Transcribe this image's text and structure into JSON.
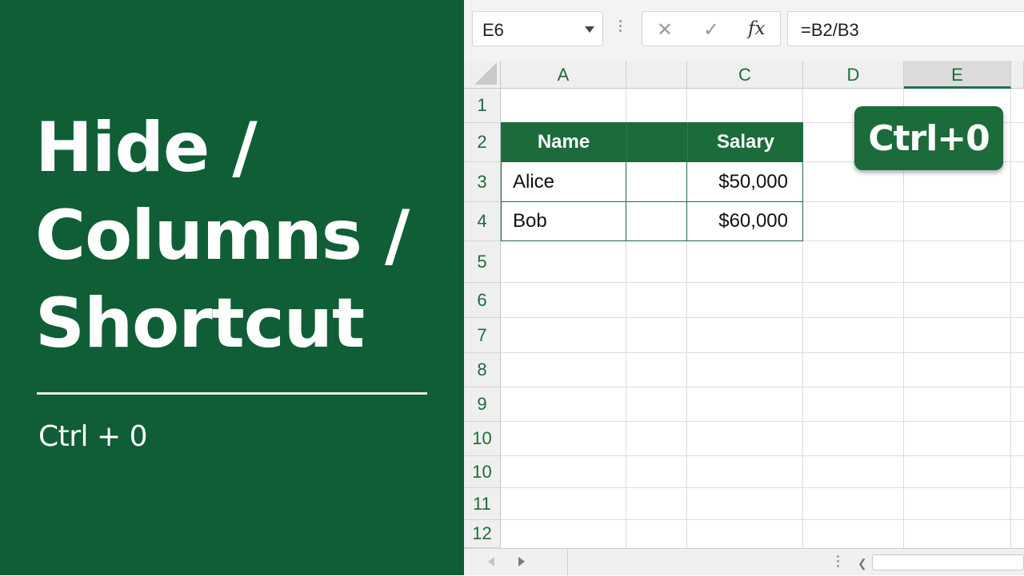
{
  "left_panel": {
    "title_lines": [
      "Hide /",
      "Columns /",
      "Shortcut"
    ],
    "subtitle": "Ctrl + 0",
    "background_color": "#0f5e36"
  },
  "formula_bar": {
    "name_box": "E6",
    "cancel_icon": "✕",
    "enter_icon": "✓",
    "fx_label": "fx",
    "formula": "=B2/B3"
  },
  "columns": [
    "A",
    "",
    "C",
    "D",
    "E"
  ],
  "selected_column": "E",
  "rows": [
    "1",
    "2",
    "3",
    "4",
    "5",
    "6",
    "7",
    "8",
    "9",
    "10",
    "10",
    "11",
    "12"
  ],
  "table": {
    "headers": [
      "Name",
      "Salary"
    ],
    "rows": [
      [
        "Alice",
        "$50,000"
      ],
      [
        "Bob",
        "$60,000"
      ]
    ]
  },
  "shortcut_badge": "Ctrl+0",
  "colors": {
    "accent_green": "#1c6b3b",
    "header_text_green": "#1d6b3c"
  },
  "icons": {
    "name_box_dropdown": "chevron-down-icon",
    "cancel": "close-icon",
    "enter": "check-icon",
    "function": "function-icon"
  }
}
